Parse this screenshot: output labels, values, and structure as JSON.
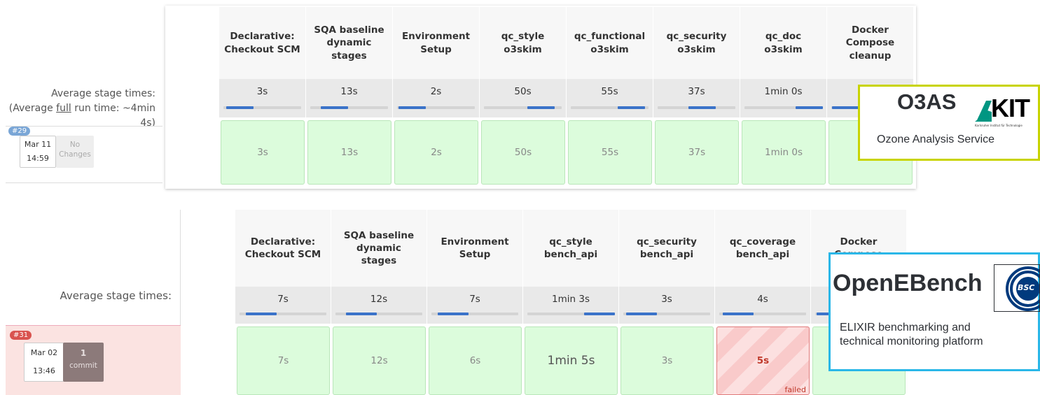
{
  "top_panel": {
    "avg_label_line1": "Average stage times:",
    "avg_label_line2_prefix": "(Average ",
    "avg_label_line2_link": "full",
    "avg_label_line2_suffix": " run time: ~4min",
    "avg_label_line3": "4s)",
    "build": {
      "number": "#29",
      "date": "Mar 11",
      "time": "14:59",
      "changes": "No\nChanges"
    },
    "stages": [
      {
        "name": "Declarative:\nCheckout SCM",
        "avg": "3s",
        "result": "3s",
        "avg_fraction": 0.05,
        "status": "success"
      },
      {
        "name": "SQA baseline\ndynamic\nstages",
        "avg": "13s",
        "result": "13s",
        "avg_fraction": 0.2,
        "status": "success"
      },
      {
        "name": "Environment\nSetup",
        "avg": "2s",
        "result": "2s",
        "avg_fraction": 0.03,
        "status": "success"
      },
      {
        "name": "qc_style\no3skim",
        "avg": "50s",
        "result": "50s",
        "avg_fraction": 0.85,
        "status": "success"
      },
      {
        "name": "qc_functional\no3skim",
        "avg": "55s",
        "result": "55s",
        "avg_fraction": 0.92,
        "status": "success"
      },
      {
        "name": "qc_security\no3skim",
        "avg": "37s",
        "result": "37s",
        "avg_fraction": 0.6,
        "status": "success"
      },
      {
        "name": "qc_doc\no3skim",
        "avg": "1min 0s",
        "result": "1min 0s",
        "avg_fraction": 1.0,
        "status": "success"
      },
      {
        "name": "Docker\nCompose\ncleanup",
        "avg": "",
        "result": "",
        "avg_fraction": 0.02,
        "status": "success"
      }
    ]
  },
  "bottom_panel": {
    "avg_label_line1": "Average stage times:",
    "build": {
      "number": "#31",
      "date": "Mar 02",
      "time": "13:46",
      "changes_count": "1",
      "changes_label": "commit"
    },
    "stages": [
      {
        "name": "Declarative:\nCheckout SCM",
        "avg": "7s",
        "result": "7s",
        "avg_fraction": 0.11,
        "status": "success"
      },
      {
        "name": "SQA baseline\ndynamic\nstages",
        "avg": "12s",
        "result": "12s",
        "avg_fraction": 0.19,
        "status": "success"
      },
      {
        "name": "Environment\nSetup",
        "avg": "7s",
        "result": "6s",
        "avg_fraction": 0.11,
        "status": "success"
      },
      {
        "name": "qc_style\nbench_api",
        "avg": "1min 3s",
        "result": "1min 5s",
        "avg_fraction": 1.0,
        "status": "success",
        "big": true
      },
      {
        "name": "qc_security\nbench_api",
        "avg": "3s",
        "result": "3s",
        "avg_fraction": 0.05,
        "status": "success"
      },
      {
        "name": "qc_coverage\nbench_api",
        "avg": "4s",
        "result": "5s",
        "avg_fraction": 0.06,
        "status": "failed",
        "failed_label": "failed"
      },
      {
        "name": "Docker\nCompose",
        "avg": "",
        "result": "",
        "avg_fraction": 0.02,
        "status": "success"
      }
    ]
  },
  "logos": {
    "o3as": {
      "title": "O3AS",
      "kit_text": "KIT",
      "kit_subtitle": "Karlsruher Institut für Technologie",
      "subtitle": "Ozone Analysis Service",
      "border_color": "#c8d400"
    },
    "openebench": {
      "title": "OpenEBench",
      "bsc_text": "BSC",
      "subtitle": "ELIXIR benchmarking and\ntechnical monitoring platform",
      "border_color": "#2ab7e8"
    }
  },
  "colors": {
    "success_bg": "#dcfcdc",
    "failed_bg": "#fce0e0",
    "bar": "#3b73c9",
    "badge_top": "#7aa6d6",
    "badge_bottom": "#d9534f"
  }
}
